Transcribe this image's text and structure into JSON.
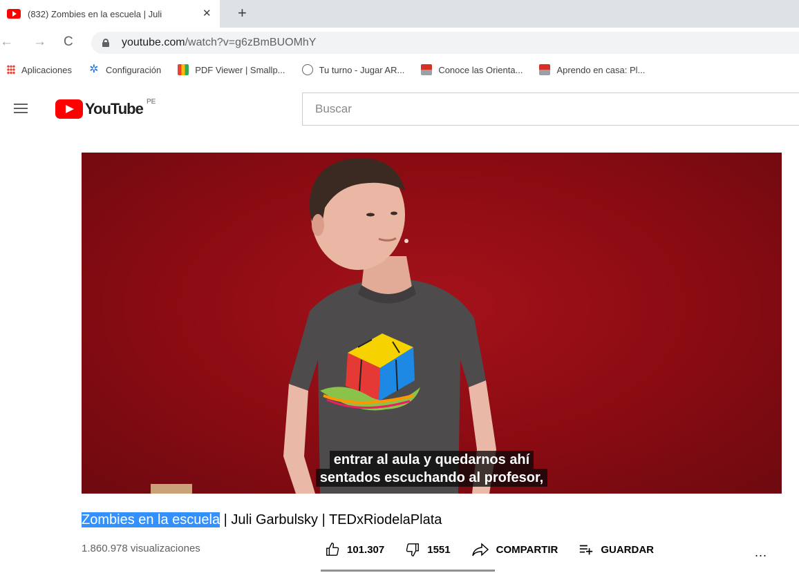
{
  "browser": {
    "tab_title": "(832) Zombies en la escuela | Juli",
    "tab_close": "✕",
    "new_tab": "+",
    "url_host": "youtube.com",
    "url_path": "/watch?v=g6zBmBUOMhY"
  },
  "bookmarks": [
    {
      "label": "Aplicaciones",
      "icon": "apps-grid-icon"
    },
    {
      "label": "Configuración",
      "icon": "gear-icon"
    },
    {
      "label": "PDF Viewer | Smallp...",
      "icon": "pdf-viewer-icon"
    },
    {
      "label": "Tu turno - Jugar AR...",
      "icon": "clock-icon"
    },
    {
      "label": "Conoce las Orienta...",
      "icon": "minedu-icon"
    },
    {
      "label": "Aprendo en casa: Pl...",
      "icon": "minedu-icon"
    }
  ],
  "youtube": {
    "logo_text": "YouTube",
    "country_code": "PE",
    "search_placeholder": "Buscar"
  },
  "video": {
    "subtitle_line1": "entrar al aula y quedarnos ahí",
    "subtitle_line2": "sentados escuchando al profesor,",
    "title_selected": "Zombies en la escuela",
    "title_rest": " | Juli Garbulsky | TEDxRiodelaPlata",
    "views": "1.860.978 visualizaciones",
    "likes": "101.307",
    "dislikes": "1551",
    "share_label": "COMPARTIR",
    "save_label": "GUARDAR",
    "more_label": "..."
  },
  "colors": {
    "youtube_red": "#ff0000",
    "selection_blue": "#3390ff",
    "stage_red": "#8a0b12"
  }
}
